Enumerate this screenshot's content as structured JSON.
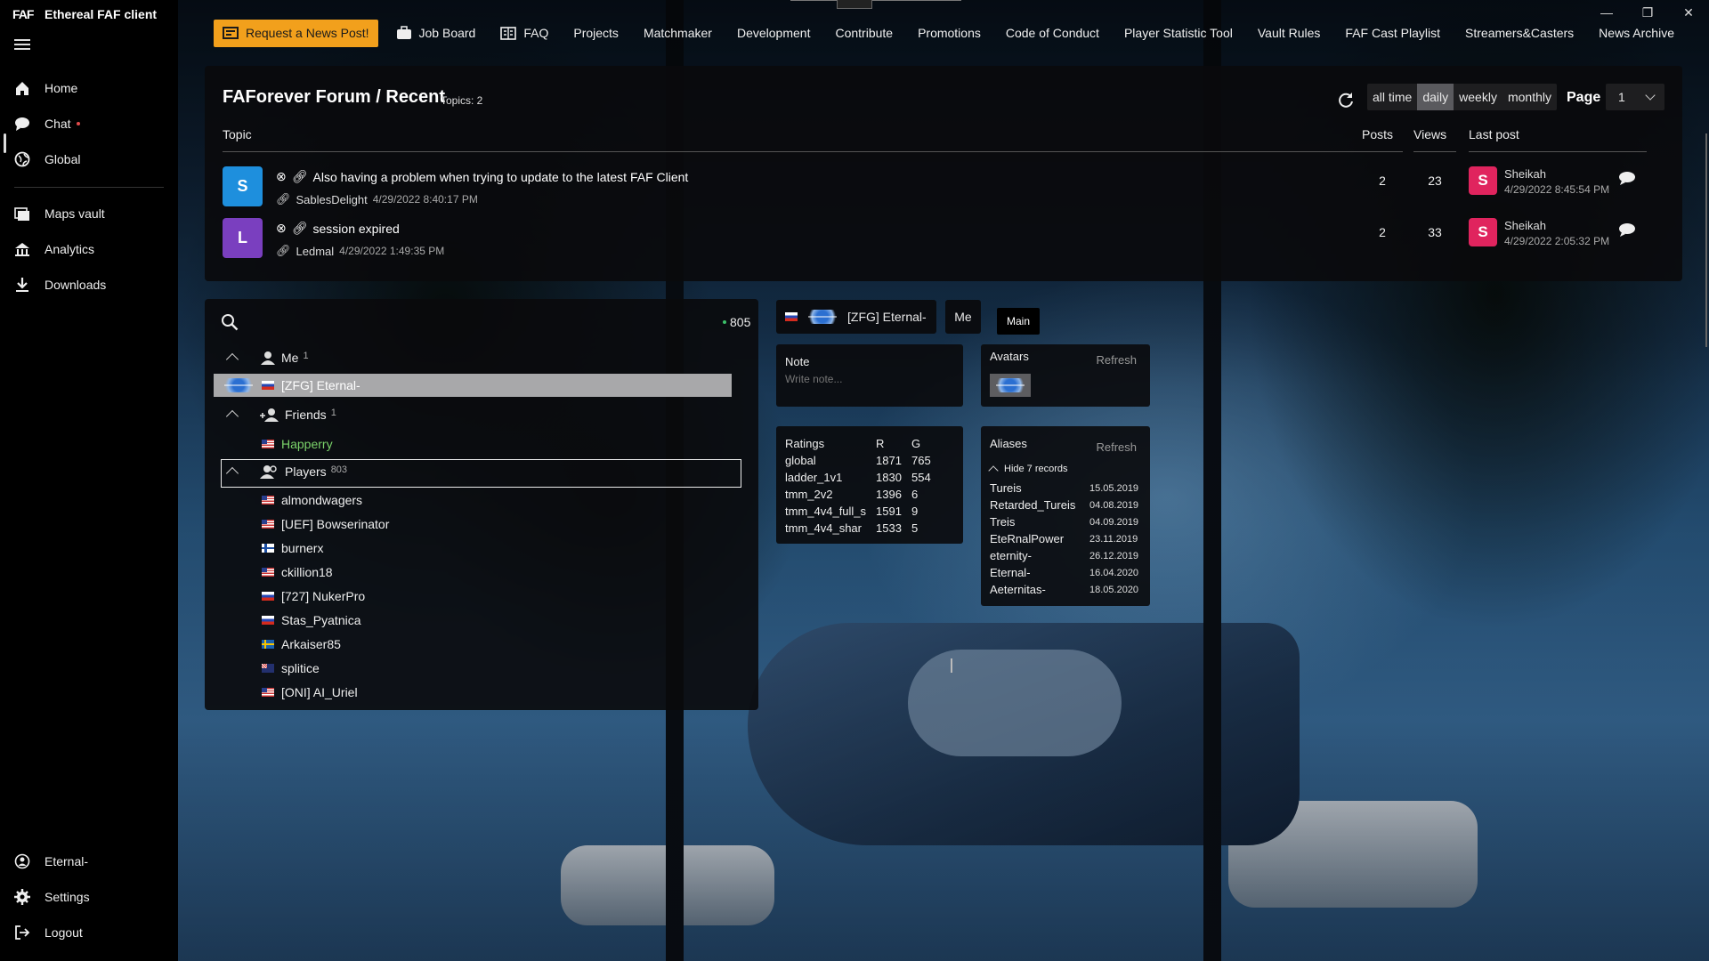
{
  "app": {
    "logo": "FAF",
    "title": "Ethereal FAF client"
  },
  "window": {
    "minimize": "—",
    "maximize": "❐",
    "close": "✕"
  },
  "nav": {
    "news_button": "Request a News Post!",
    "items": [
      "Job Board",
      "FAQ",
      "Projects",
      "Matchmaker",
      "Development",
      "Contribute",
      "Promotions",
      "Code of Conduct",
      "Player Statistic Tool",
      "Vault Rules",
      "FAF Cast Playlist",
      "Streamers&Casters",
      "News Archive"
    ]
  },
  "sidebar": {
    "top": [
      {
        "label": "Home",
        "icon": "home-icon"
      },
      {
        "label": "Chat",
        "icon": "chat-icon"
      },
      {
        "label": "Global",
        "icon": "globe-icon"
      }
    ],
    "mid": [
      {
        "label": "Maps vault",
        "icon": "maps-icon"
      },
      {
        "label": "Analytics",
        "icon": "analytics-icon"
      },
      {
        "label": "Downloads",
        "icon": "download-icon"
      }
    ],
    "bottom": [
      {
        "label": "Eternal-",
        "icon": "user-icon"
      },
      {
        "label": "Settings",
        "icon": "gear-icon"
      },
      {
        "label": "Logout",
        "icon": "logout-icon"
      }
    ]
  },
  "forum": {
    "title": "FAForever Forum / Recent",
    "topics_count": "Topics: 2",
    "filters": [
      "all time",
      "daily",
      "weekly",
      "monthly"
    ],
    "selected_filter": "daily",
    "page_label": "Page",
    "page_value": "1",
    "headers": {
      "topic": "Topic",
      "posts": "Posts",
      "views": "Views",
      "last_post": "Last post"
    },
    "rows": [
      {
        "avatar": "S",
        "avatar_color": "#1e8fdd",
        "title": "Also having a problem when trying to update to the latest FAF Client",
        "author": "SablesDelight",
        "date": "4/29/2022 8:40:17 PM",
        "posts": "2",
        "views": "23",
        "last_avatar": "S",
        "last_author": "Sheikah",
        "last_date": "4/29/2022 8:45:54 PM"
      },
      {
        "avatar": "L",
        "avatar_color": "#7a3fbf",
        "title": "session expired",
        "author": "Ledmal",
        "date": "4/29/2022 1:49:35 PM",
        "posts": "2",
        "views": "33",
        "last_avatar": "S",
        "last_author": "Sheikah",
        "last_date": "4/29/2022 2:05:32 PM"
      }
    ]
  },
  "players": {
    "online_count": "805",
    "groups": [
      {
        "label": "Me",
        "count": "1"
      },
      {
        "label": "Friends",
        "count": "1"
      },
      {
        "label": "Players",
        "count": "803"
      }
    ],
    "me": "[ZFG] Eternal-",
    "friends": [
      "Happerry"
    ],
    "list": [
      {
        "name": "almondwagers",
        "flag": "us"
      },
      {
        "name": "[UEF] Bowserinator",
        "flag": "us"
      },
      {
        "name": "burnerx",
        "flag": "fi"
      },
      {
        "name": "ckillion18",
        "flag": "us"
      },
      {
        "name": "[727] NukerPro",
        "flag": "ru"
      },
      {
        "name": "Stas_Pyatnica",
        "flag": "ru"
      },
      {
        "name": "Arkaiser85",
        "flag": "se"
      },
      {
        "name": "splitice",
        "flag": "au"
      },
      {
        "name": "[ONI] AI_Uriel",
        "flag": "us"
      }
    ]
  },
  "profile": {
    "name": "[ZFG] Eternal-",
    "me_tab": "Me",
    "main_tab": "Main",
    "note_title": "Note",
    "note_placeholder": "Write note...",
    "avatars_title": "Avatars",
    "refresh": "Refresh",
    "ratings": {
      "title": "Ratings",
      "col_r": "R",
      "col_g": "G",
      "rows": [
        [
          "global",
          "1871",
          "765"
        ],
        [
          "ladder_1v1",
          "1830",
          "554"
        ],
        [
          "tmm_2v2",
          "1396",
          "6"
        ],
        [
          "tmm_4v4_full_s",
          "1591",
          "9"
        ],
        [
          "tmm_4v4_shar",
          "1533",
          "5"
        ]
      ]
    },
    "aliases": {
      "title": "Aliases",
      "hide": "Hide 7 records",
      "rows": [
        [
          "Tureis",
          "15.05.2019"
        ],
        [
          "Retarded_Tureis",
          "04.08.2019"
        ],
        [
          "Treis",
          "04.09.2019"
        ],
        [
          "EteRnalPower",
          "23.11.2019"
        ],
        [
          "eternity-",
          "26.12.2019"
        ],
        [
          "Eternal-",
          "16.04.2020"
        ],
        [
          "Aeternitas-",
          "18.05.2020"
        ]
      ]
    }
  }
}
